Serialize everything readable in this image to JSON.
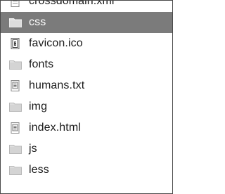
{
  "files": [
    {
      "name": "crossdomain.xml",
      "icon": "document-icon",
      "selected": false
    },
    {
      "name": "css",
      "icon": "folder-icon",
      "selected": true
    },
    {
      "name": "favicon.ico",
      "icon": "image-file-icon",
      "selected": false
    },
    {
      "name": "fonts",
      "icon": "folder-icon",
      "selected": false
    },
    {
      "name": "humans.txt",
      "icon": "text-file-icon",
      "selected": false
    },
    {
      "name": "img",
      "icon": "folder-icon",
      "selected": false
    },
    {
      "name": "index.html",
      "icon": "html-file-icon",
      "selected": false
    },
    {
      "name": "js",
      "icon": "folder-icon",
      "selected": false
    },
    {
      "name": "less",
      "icon": "folder-icon",
      "selected": false
    }
  ],
  "colors": {
    "selection": "#7b7b7b",
    "text": "#1a1a1a",
    "selected_text": "#ffffff",
    "folder": "#d6d6d6",
    "border": "#4a4a4a"
  }
}
